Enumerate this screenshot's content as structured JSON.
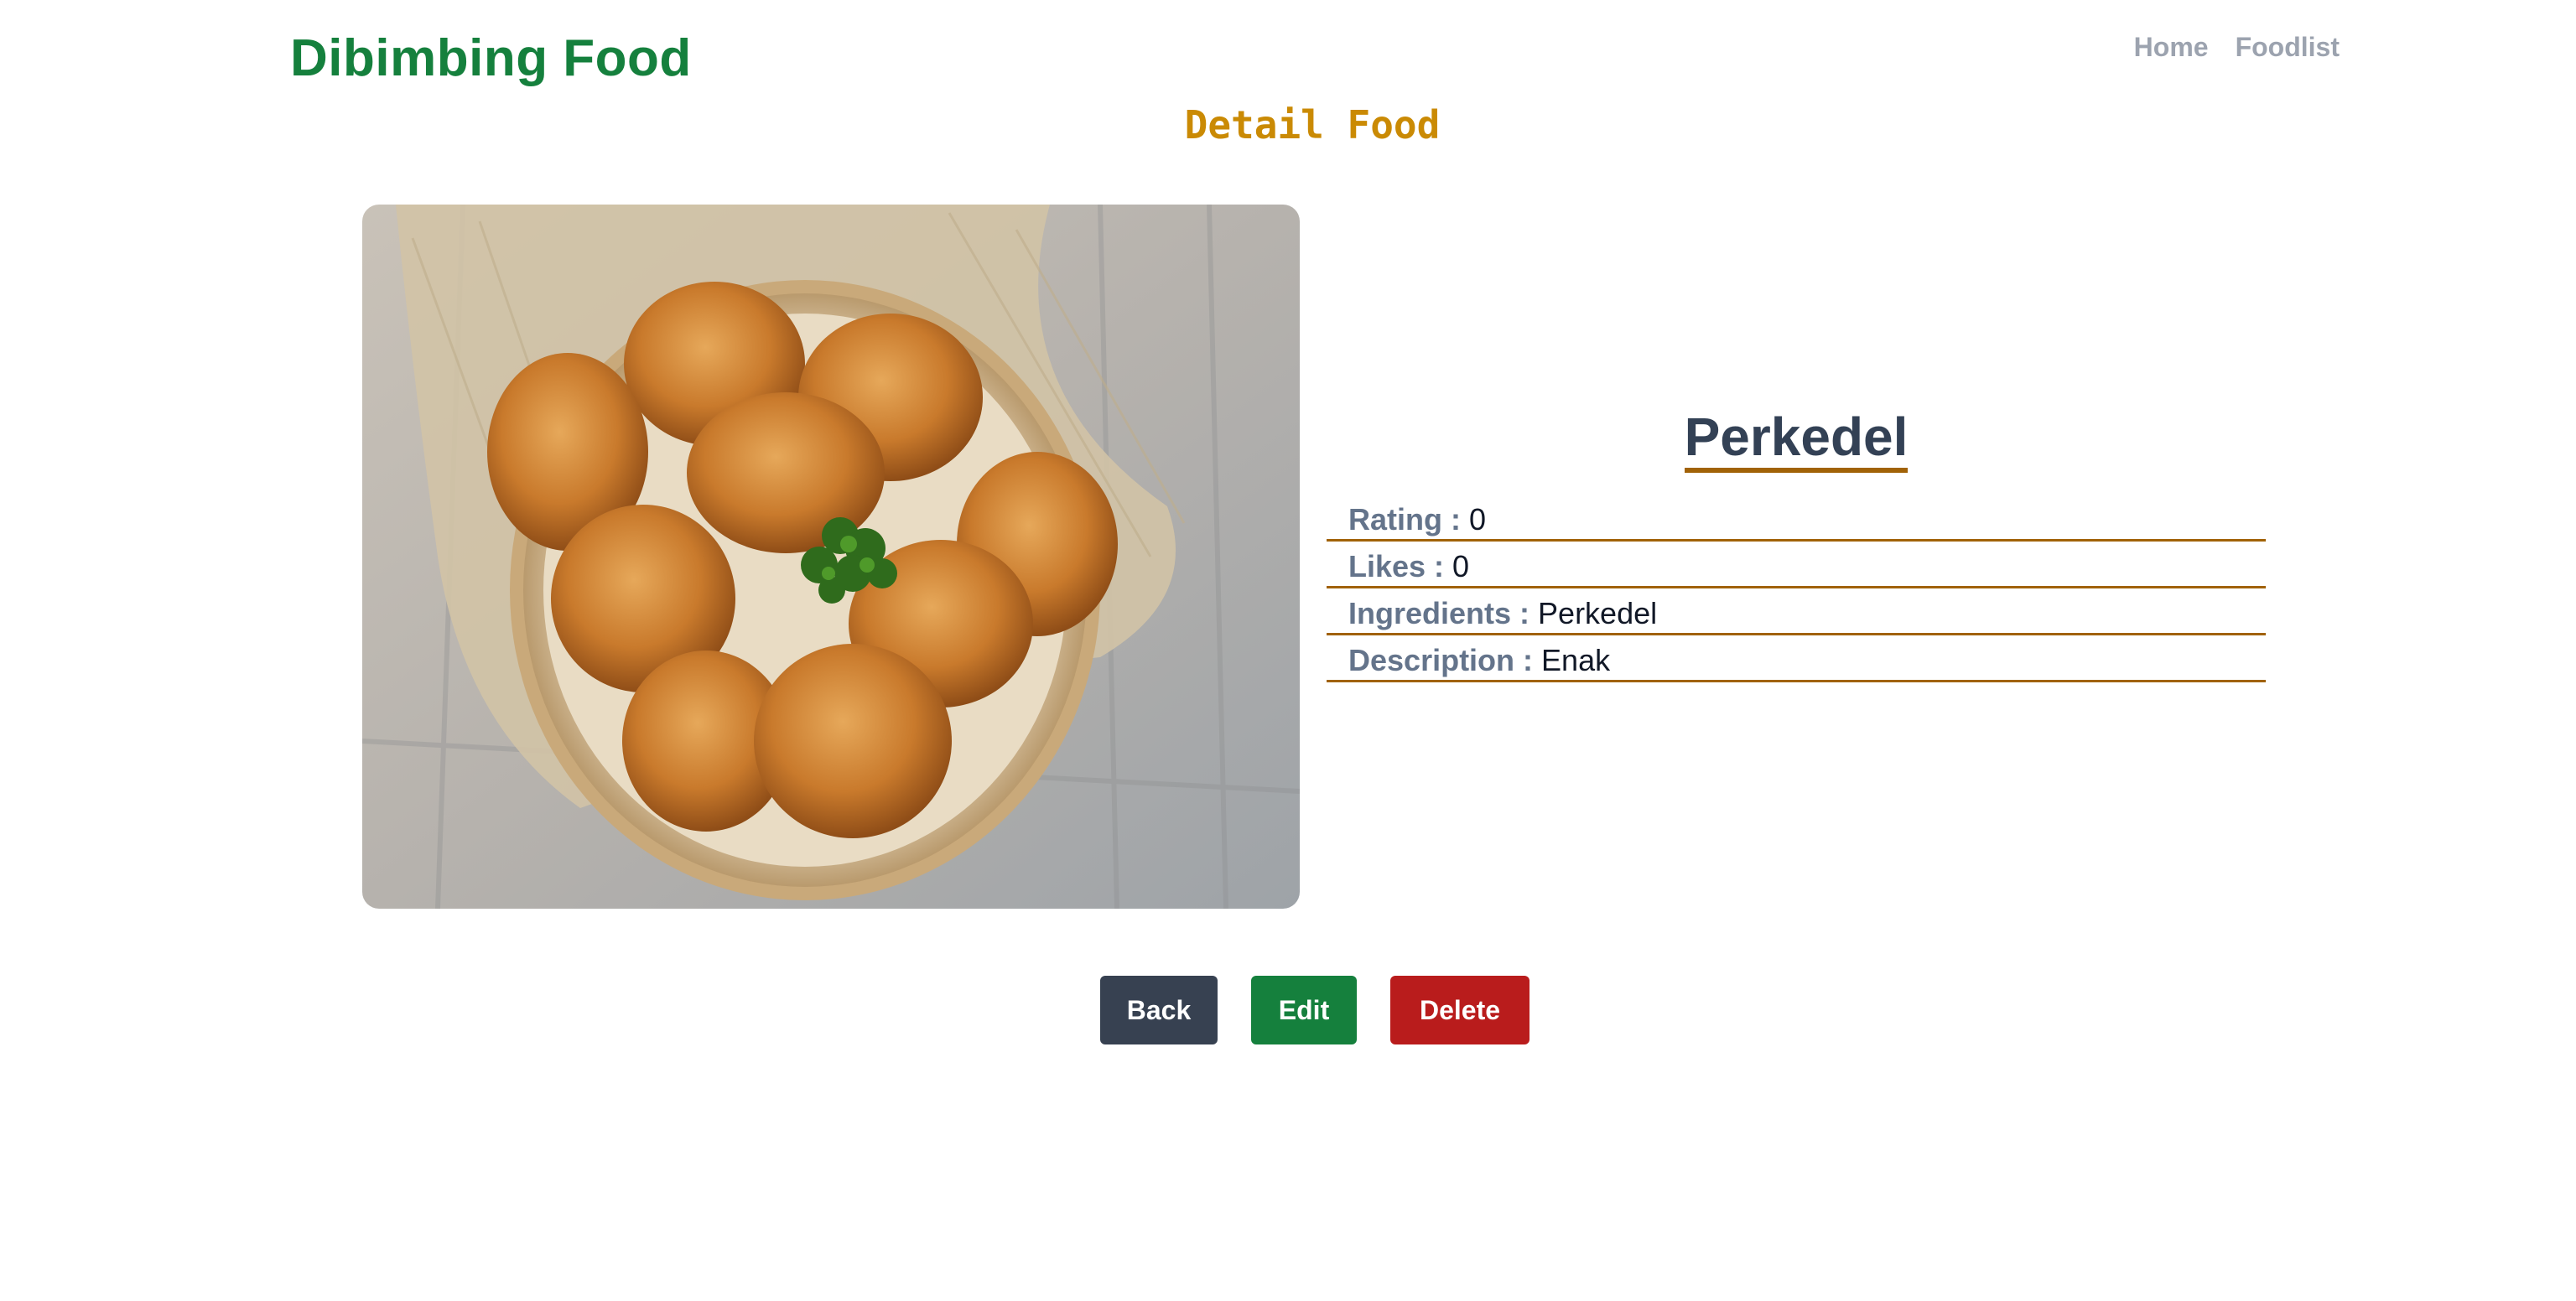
{
  "header": {
    "brand": "Dibimbing Food",
    "nav": {
      "home": "Home",
      "foodlist": "Foodlist"
    }
  },
  "page": {
    "heading": "Detail Food"
  },
  "food": {
    "name": "Perkedel",
    "rating_label": "Rating :",
    "rating": "0",
    "likes_label": "Likes :",
    "likes": "0",
    "ingredients_label": "Ingredients :",
    "ingredients": "Perkedel",
    "description_label": "Description :",
    "description": "Enak"
  },
  "actions": {
    "back": "Back",
    "edit": "Edit",
    "delete": "Delete"
  },
  "colors": {
    "brand": "#15803d",
    "heading": "#ca8a04",
    "underline": "#a16207",
    "back_button": "#374151",
    "edit_button": "#15803d",
    "delete_button": "#b91c1c"
  }
}
